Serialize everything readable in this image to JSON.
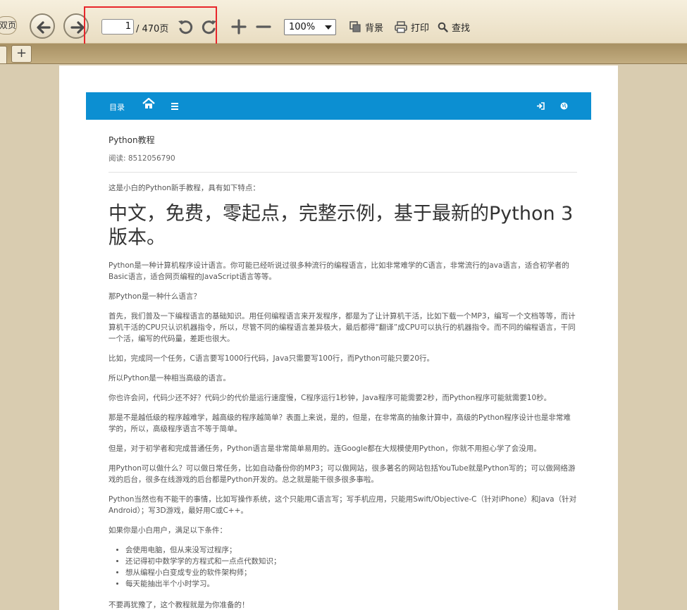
{
  "toolbar": {
    "partial_button_label": "双页",
    "page_current": "1",
    "page_total": "/ 470页",
    "zoom": "100%",
    "background_label": "背景",
    "print_label": "打印",
    "find_label": "查找"
  },
  "tabs": {
    "add_label": "+"
  },
  "nav": {
    "toc_label": "目录"
  },
  "article": {
    "title": "Python教程",
    "meta": "阅读: 8512056790",
    "intro": "这是小白的Python新手教程，具有如下特点：",
    "headline": "中文，免费，零起点，完整示例，基于最新的Python 3版本。",
    "paragraphs": [
      "Python是一种计算机程序设计语言。你可能已经听说过很多种流行的编程语言，比如非常难学的C语言，非常流行的Java语言，适合初学者的Basic语言，适合网页编程的JavaScript语言等等。",
      "那Python是一种什么语言？",
      "首先，我们普及一下编程语言的基础知识。用任何编程语言来开发程序，都是为了让计算机干活，比如下载一个MP3，编写一个文档等等，而计算机干活的CPU只认识机器指令，所以，尽管不同的编程语言差异极大，最后都得“翻译”成CPU可以执行的机器指令。而不同的编程语言，干同一个活，编写的代码量，差距也很大。",
      "比如，完成同一个任务，C语言要写1000行代码，Java只需要写100行，而Python可能只要20行。",
      "所以Python是一种相当高级的语言。",
      "你也许会问，代码少还不好？代码少的代价是运行速度慢，C程序运行1秒钟，Java程序可能需要2秒，而Python程序可能就需要10秒。",
      "那是不是越低级的程序越难学，越高级的程序越简单？表面上来说，是的，但是，在非常高的抽象计算中，高级的Python程序设计也是非常难学的，所以，高级程序语言不等于简单。",
      "但是，对于初学者和完成普通任务，Python语言是非常简单易用的。连Google都在大规模使用Python，你就不用担心学了会没用。",
      "用Python可以做什么？可以做日常任务，比如自动备份你的MP3；可以做网站，很多著名的网站包括YouTube就是Python写的；可以做网络游戏的后台，很多在线游戏的后台都是Python开发的。总之就是能干很多很多事啦。",
      "Python当然也有不能干的事情，比如写操作系统，这个只能用C语言写；写手机应用，只能用Swift/Objective-C（针对iPhone）和Java（针对Android）；写3D游戏，最好用C或C++。",
      "如果你是小白用户，满足以下条件："
    ],
    "list": [
      "会使用电脑，但从来没写过程序；",
      "还记得初中数学学的方程式和一点点代数知识；",
      "想从编程小白变成专业的软件架构师；",
      "每天能抽出半个小时学习。"
    ],
    "closing": "不要再犹豫了，这个教程就是为你准备的！"
  },
  "colors": {
    "navbar": "#0c8fd2",
    "highlight_box": "#e8262b",
    "app_background": "#d9ccb0"
  }
}
